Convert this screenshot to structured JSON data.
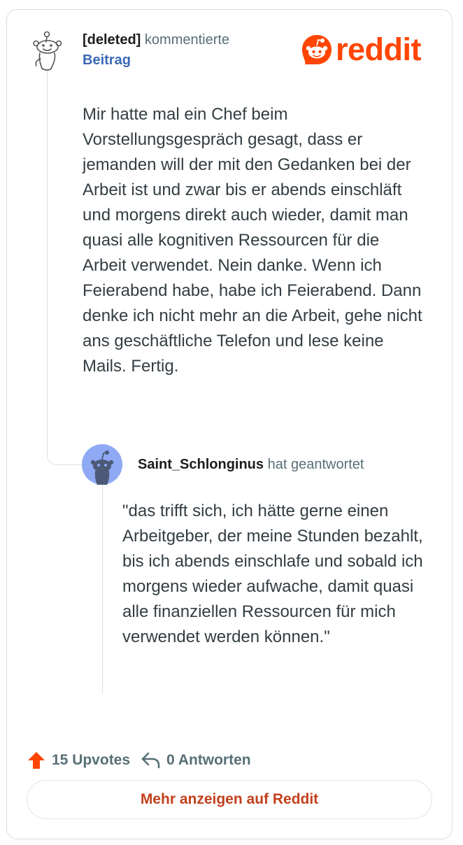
{
  "post": {
    "author": "[deleted]",
    "action": "kommentierte",
    "target": "Beitrag",
    "body": "Mir hatte mal ein Chef beim Vorstellungsgespräch gesagt, dass er jemanden will der mit den Gedanken bei der Arbeit ist und zwar bis er abends einschläft und morgens direkt auch wieder, damit man quasi alle kognitiven Ressourcen für die Arbeit verwendet. Nein danke. Wenn ich Feierabend habe, habe ich Feierabend. Dann denke ich nicht mehr an die Arbeit, gehe nicht ans geschäftliche Telefon und lese keine Mails. Fertig."
  },
  "logo": {
    "wordmark": "reddit",
    "icon": "reddit-snoo-icon"
  },
  "reply": {
    "author": "Saint_Schlonginus",
    "action": "hat geantwortet",
    "body": "\"das trifft sich, ich hätte gerne einen Arbeitgeber, der meine Stunden bezahlt, bis ich abends einschlafe und sobald ich morgens wieder aufwache, damit quasi alle finanziellen Ressourcen für mich verwendet werden können.\""
  },
  "footer": {
    "upvotes": "15 Upvotes",
    "replies": "0 Antworten",
    "more_button": "Mehr anzeigen auf Reddit"
  },
  "colors": {
    "brand": "#ff4500",
    "link": "#3a69b5",
    "muted": "#576f76",
    "button_text": "#c2401c"
  }
}
